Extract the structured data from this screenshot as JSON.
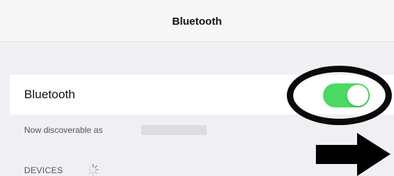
{
  "nav": {
    "title": "Bluetooth"
  },
  "bluetooth_row": {
    "label": "Bluetooth",
    "toggle_on": true
  },
  "discoverable": {
    "text": "Now discoverable as"
  },
  "devices": {
    "header": "DEVICES"
  },
  "colors": {
    "toggle_on": "#4cd964",
    "background": "#efeff4",
    "annotation": "#0a0a0a"
  },
  "icons": {
    "spinner": "activity-spinner-icon",
    "arrow": "right-arrow-icon"
  }
}
